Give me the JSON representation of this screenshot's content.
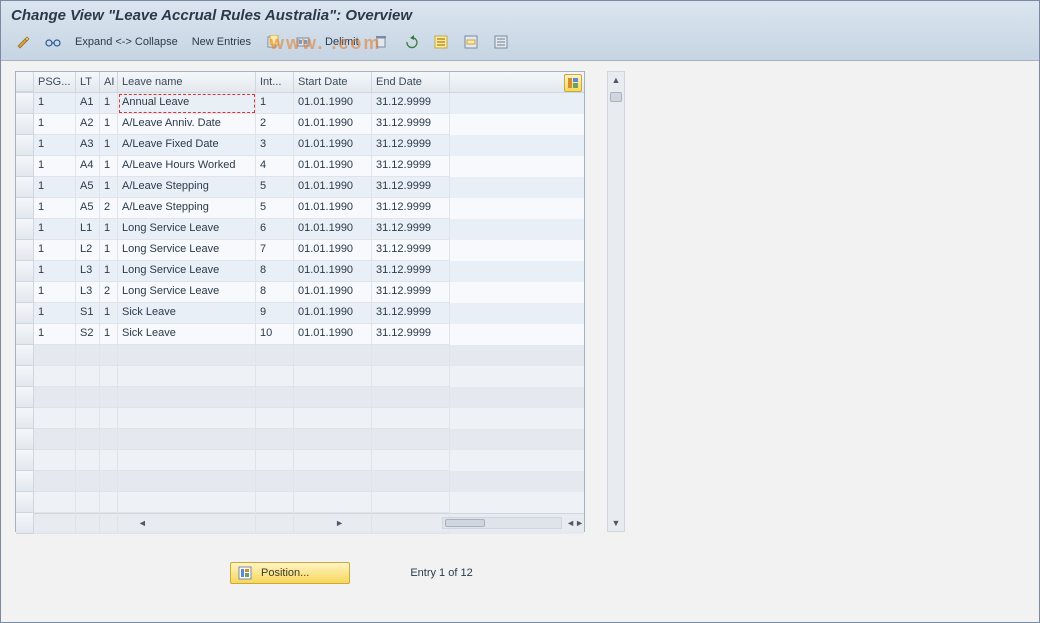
{
  "title": "Change View \"Leave Accrual Rules Australia\": Overview",
  "toolbar": {
    "expand": "Expand <-> Collapse",
    "new_entries": "New Entries",
    "delimit": "Delimit"
  },
  "watermark": "www.               .com",
  "columns": {
    "psg": "PSG...",
    "lt": "LT",
    "ai": "AI",
    "leave_name": "Leave name",
    "int": "Int...",
    "start": "Start Date",
    "end": "End Date"
  },
  "rows": [
    {
      "psg": "1",
      "lt": "A1",
      "ai": "1",
      "leave_name": "Annual Leave",
      "int": "1",
      "start": "01.01.1990",
      "end": "31.12.9999"
    },
    {
      "psg": "1",
      "lt": "A2",
      "ai": "1",
      "leave_name": "A/Leave Anniv. Date",
      "int": "2",
      "start": "01.01.1990",
      "end": "31.12.9999"
    },
    {
      "psg": "1",
      "lt": "A3",
      "ai": "1",
      "leave_name": "A/Leave Fixed Date",
      "int": "3",
      "start": "01.01.1990",
      "end": "31.12.9999"
    },
    {
      "psg": "1",
      "lt": "A4",
      "ai": "1",
      "leave_name": "A/Leave Hours Worked",
      "int": "4",
      "start": "01.01.1990",
      "end": "31.12.9999"
    },
    {
      "psg": "1",
      "lt": "A5",
      "ai": "1",
      "leave_name": "A/Leave Stepping",
      "int": "5",
      "start": "01.01.1990",
      "end": "31.12.9999"
    },
    {
      "psg": "1",
      "lt": "A5",
      "ai": "2",
      "leave_name": "A/Leave Stepping",
      "int": "5",
      "start": "01.01.1990",
      "end": "31.12.9999"
    },
    {
      "psg": "1",
      "lt": "L1",
      "ai": "1",
      "leave_name": "Long Service Leave",
      "int": "6",
      "start": "01.01.1990",
      "end": "31.12.9999"
    },
    {
      "psg": "1",
      "lt": "L2",
      "ai": "1",
      "leave_name": "Long Service Leave",
      "int": "7",
      "start": "01.01.1990",
      "end": "31.12.9999"
    },
    {
      "psg": "1",
      "lt": "L3",
      "ai": "1",
      "leave_name": "Long Service Leave",
      "int": "8",
      "start": "01.01.1990",
      "end": "31.12.9999"
    },
    {
      "psg": "1",
      "lt": "L3",
      "ai": "2",
      "leave_name": "Long Service Leave",
      "int": "8",
      "start": "01.01.1990",
      "end": "31.12.9999"
    },
    {
      "psg": "1",
      "lt": "S1",
      "ai": "1",
      "leave_name": "Sick Leave",
      "int": "9",
      "start": "01.01.1990",
      "end": "31.12.9999"
    },
    {
      "psg": "1",
      "lt": "S2",
      "ai": "1",
      "leave_name": "Sick Leave",
      "int": "10",
      "start": "01.01.1990",
      "end": "31.12.9999"
    }
  ],
  "empty_rows": 9,
  "footer": {
    "position": "Position...",
    "status": "Entry 1 of 12"
  }
}
